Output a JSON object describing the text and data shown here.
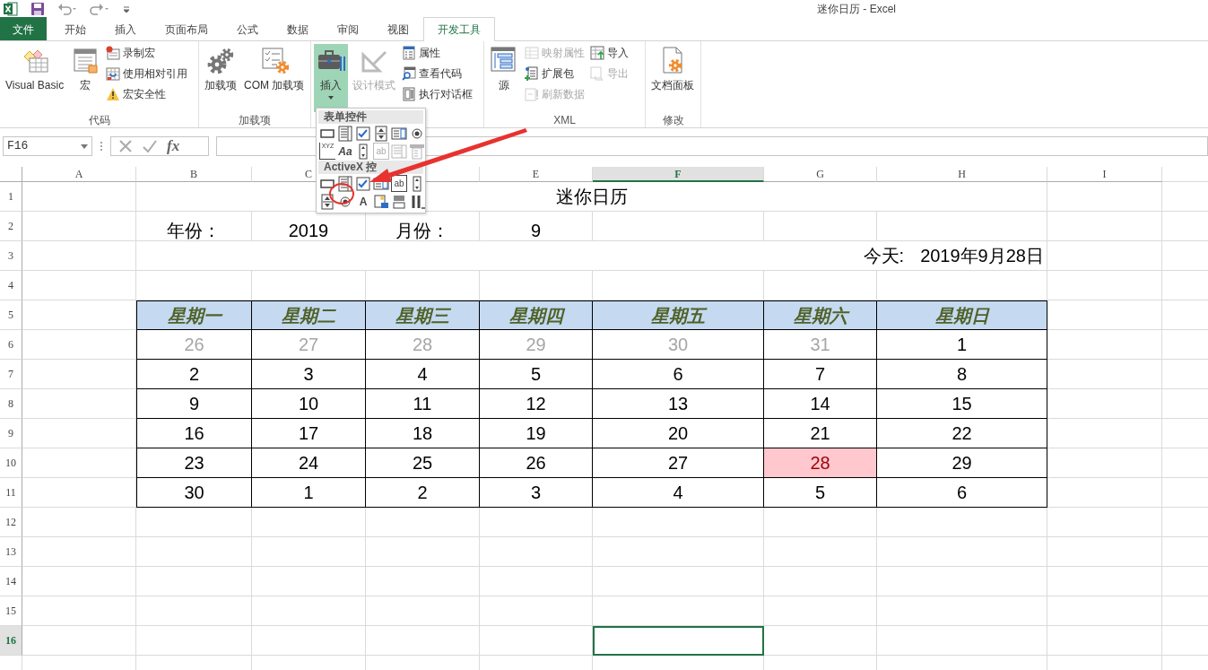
{
  "window": {
    "title": "迷你日历 - Excel"
  },
  "ribbon_tabs": [
    {
      "label": "文件",
      "kind": "file",
      "selected": false
    },
    {
      "label": "开始",
      "kind": "tab",
      "selected": false
    },
    {
      "label": "插入",
      "kind": "tab",
      "selected": false
    },
    {
      "label": "页面布局",
      "kind": "tab",
      "selected": false
    },
    {
      "label": "公式",
      "kind": "tab",
      "selected": false
    },
    {
      "label": "数据",
      "kind": "tab",
      "selected": false
    },
    {
      "label": "审阅",
      "kind": "tab",
      "selected": false
    },
    {
      "label": "视图",
      "kind": "tab",
      "selected": false
    },
    {
      "label": "开发工具",
      "kind": "tab",
      "selected": true
    }
  ],
  "ribbon_groups": [
    {
      "label": "代码",
      "items": [
        {
          "label": "Visual Basic",
          "kind": "large",
          "disabled": false,
          "pressed": false
        },
        {
          "label": "宏",
          "kind": "large",
          "disabled": false,
          "pressed": false
        },
        {
          "label": "录制宏",
          "kind": "small",
          "disabled": false,
          "pressed": false
        },
        {
          "label": "使用相对引用",
          "kind": "small",
          "disabled": false,
          "pressed": false
        },
        {
          "label": "宏安全性",
          "kind": "small",
          "disabled": false,
          "pressed": false
        }
      ]
    },
    {
      "label": "加载项",
      "items": [
        {
          "label": "加载项",
          "kind": "large",
          "disabled": false,
          "pressed": false
        },
        {
          "label": "COM 加载项",
          "kind": "large",
          "disabled": false,
          "pressed": false
        }
      ]
    },
    {
      "items": [
        {
          "label": "插入",
          "kind": "large",
          "disabled": false,
          "pressed": true
        },
        {
          "label": "设计模式",
          "kind": "large",
          "disabled": true,
          "pressed": false
        },
        {
          "label": "属性",
          "kind": "small",
          "disabled": false,
          "pressed": false
        },
        {
          "label": "查看代码",
          "kind": "small",
          "disabled": false,
          "pressed": false
        },
        {
          "label": "执行对话框",
          "kind": "small",
          "disabled": false,
          "pressed": false
        }
      ]
    },
    {
      "label": "XML",
      "items": [
        {
          "label": "源",
          "kind": "large",
          "disabled": false,
          "pressed": false
        },
        {
          "label": "映射属性",
          "kind": "small",
          "disabled": true,
          "pressed": false
        },
        {
          "label": "扩展包",
          "kind": "small",
          "disabled": false,
          "pressed": false
        },
        {
          "label": "刷新数据",
          "kind": "small",
          "disabled": true,
          "pressed": false
        },
        {
          "label": "导入",
          "kind": "small",
          "disabled": false,
          "pressed": false
        },
        {
          "label": "导出",
          "kind": "small",
          "disabled": true,
          "pressed": false
        }
      ]
    },
    {
      "label": "修改",
      "items": [
        {
          "label": "文档面板",
          "kind": "large",
          "disabled": false,
          "pressed": false
        }
      ]
    }
  ],
  "insert_menu": {
    "sections": [
      {
        "title": "表单控件",
        "controls": [
          {
            "kind": "button",
            "disabled": false
          },
          {
            "kind": "combo",
            "disabled": false
          },
          {
            "kind": "check",
            "disabled": false
          },
          {
            "kind": "spin",
            "disabled": false
          },
          {
            "kind": "list",
            "disabled": false
          },
          {
            "kind": "option",
            "disabled": false
          },
          {
            "kind": "group",
            "text": "XYZ",
            "disabled": false
          },
          {
            "kind": "label",
            "text": "Aa",
            "disabled": false
          },
          {
            "kind": "scroll",
            "disabled": false
          },
          {
            "kind": "textbox",
            "text": "ab",
            "disabled": true
          },
          {
            "kind": "combolist",
            "disabled": true
          },
          {
            "kind": "combodrop",
            "disabled": true
          }
        ]
      },
      {
        "title": "ActiveX 控",
        "controls": [
          {
            "kind": "button",
            "disabled": false
          },
          {
            "kind": "combo",
            "disabled": false
          },
          {
            "kind": "check",
            "disabled": false
          },
          {
            "kind": "list",
            "disabled": false
          },
          {
            "kind": "textbox",
            "text": "ab",
            "disabled": false
          },
          {
            "kind": "scroll",
            "disabled": false
          },
          {
            "kind": "spin",
            "disabled": false
          },
          {
            "kind": "option",
            "disabled": false
          },
          {
            "kind": "label",
            "text": "A",
            "disabled": false
          },
          {
            "kind": "image",
            "disabled": false
          },
          {
            "kind": "toggle",
            "disabled": false
          },
          {
            "kind": "more",
            "disabled": false
          }
        ]
      }
    ]
  },
  "formula_bar": {
    "name_box": "F16",
    "function_label": "fx"
  },
  "sheet": {
    "columns": [
      {
        "label": "A",
        "selected": false
      },
      {
        "label": "B",
        "selected": false
      },
      {
        "label": "C",
        "selected": false
      },
      null,
      {
        "label": "E",
        "selected": false
      },
      {
        "label": "F",
        "selected": true
      },
      {
        "label": "G",
        "selected": false
      },
      {
        "label": "H",
        "selected": false
      },
      {
        "label": "I",
        "selected": false
      }
    ],
    "rows": [
      {
        "label": "1",
        "selected": false
      },
      {
        "label": "2",
        "selected": false
      },
      {
        "label": "3",
        "selected": false
      },
      {
        "label": "4",
        "selected": false
      },
      {
        "label": "5",
        "selected": false
      },
      {
        "label": "6",
        "selected": false
      },
      {
        "label": "7",
        "selected": false
      },
      {
        "label": "8",
        "selected": false
      },
      {
        "label": "9",
        "selected": false
      },
      {
        "label": "10",
        "selected": false
      },
      {
        "label": "11",
        "selected": false
      },
      {
        "label": "12",
        "selected": false
      },
      {
        "label": "13",
        "selected": false
      },
      {
        "label": "14",
        "selected": false
      },
      {
        "label": "15",
        "selected": false
      },
      {
        "label": "16",
        "selected": true
      }
    ],
    "title": "迷你日历",
    "year_label": "年份：",
    "year": "2019",
    "month_label": "月份：",
    "month": "9",
    "today_label": "今天:",
    "today": "2019年9月28日",
    "calendar": {
      "weekdays": [
        "星期一",
        "星期二",
        "星期三",
        "星期四",
        "星期五",
        "星期六",
        "星期日"
      ],
      "weeks": [
        [
          {
            "day": "26",
            "muted": true,
            "selected": false
          },
          {
            "day": "27",
            "muted": true,
            "selected": false
          },
          {
            "day": "28",
            "muted": true,
            "selected": false
          },
          {
            "day": "29",
            "muted": true,
            "selected": false
          },
          {
            "day": "30",
            "muted": true,
            "selected": false
          },
          {
            "day": "31",
            "muted": true,
            "selected": false
          },
          {
            "day": "1",
            "muted": false,
            "selected": false
          }
        ],
        [
          {
            "day": "2",
            "muted": false,
            "selected": false
          },
          {
            "day": "3",
            "muted": false,
            "selected": false
          },
          {
            "day": "4",
            "muted": false,
            "selected": false
          },
          {
            "day": "5",
            "muted": false,
            "selected": false
          },
          {
            "day": "6",
            "muted": false,
            "selected": false
          },
          {
            "day": "7",
            "muted": false,
            "selected": false
          },
          {
            "day": "8",
            "muted": false,
            "selected": false
          }
        ],
        [
          {
            "day": "9",
            "muted": false,
            "selected": false
          },
          {
            "day": "10",
            "muted": false,
            "selected": false
          },
          {
            "day": "11",
            "muted": false,
            "selected": false
          },
          {
            "day": "12",
            "muted": false,
            "selected": false
          },
          {
            "day": "13",
            "muted": false,
            "selected": false
          },
          {
            "day": "14",
            "muted": false,
            "selected": false
          },
          {
            "day": "15",
            "muted": false,
            "selected": false
          }
        ],
        [
          {
            "day": "16",
            "muted": false,
            "selected": false
          },
          {
            "day": "17",
            "muted": false,
            "selected": false
          },
          {
            "day": "18",
            "muted": false,
            "selected": false
          },
          {
            "day": "19",
            "muted": false,
            "selected": false
          },
          {
            "day": "20",
            "muted": false,
            "selected": false
          },
          {
            "day": "21",
            "muted": false,
            "selected": false
          },
          {
            "day": "22",
            "muted": false,
            "selected": false
          }
        ],
        [
          {
            "day": "23",
            "muted": false,
            "selected": false
          },
          {
            "day": "24",
            "muted": false,
            "selected": false
          },
          {
            "day": "25",
            "muted": false,
            "selected": false
          },
          {
            "day": "26",
            "muted": false,
            "selected": false
          },
          {
            "day": "27",
            "muted": false,
            "selected": false
          },
          {
            "day": "28",
            "muted": false,
            "selected": true
          },
          {
            "day": "29",
            "muted": false,
            "selected": false
          }
        ],
        [
          {
            "day": "30",
            "muted": false,
            "selected": false
          },
          {
            "day": "1",
            "muted": false,
            "selected": false
          },
          {
            "day": "2",
            "muted": false,
            "selected": false
          },
          {
            "day": "3",
            "muted": false,
            "selected": false
          },
          {
            "day": "4",
            "muted": false,
            "selected": false
          },
          {
            "day": "5",
            "muted": false,
            "selected": false
          },
          {
            "day": "6",
            "muted": false,
            "selected": false
          }
        ]
      ]
    }
  }
}
